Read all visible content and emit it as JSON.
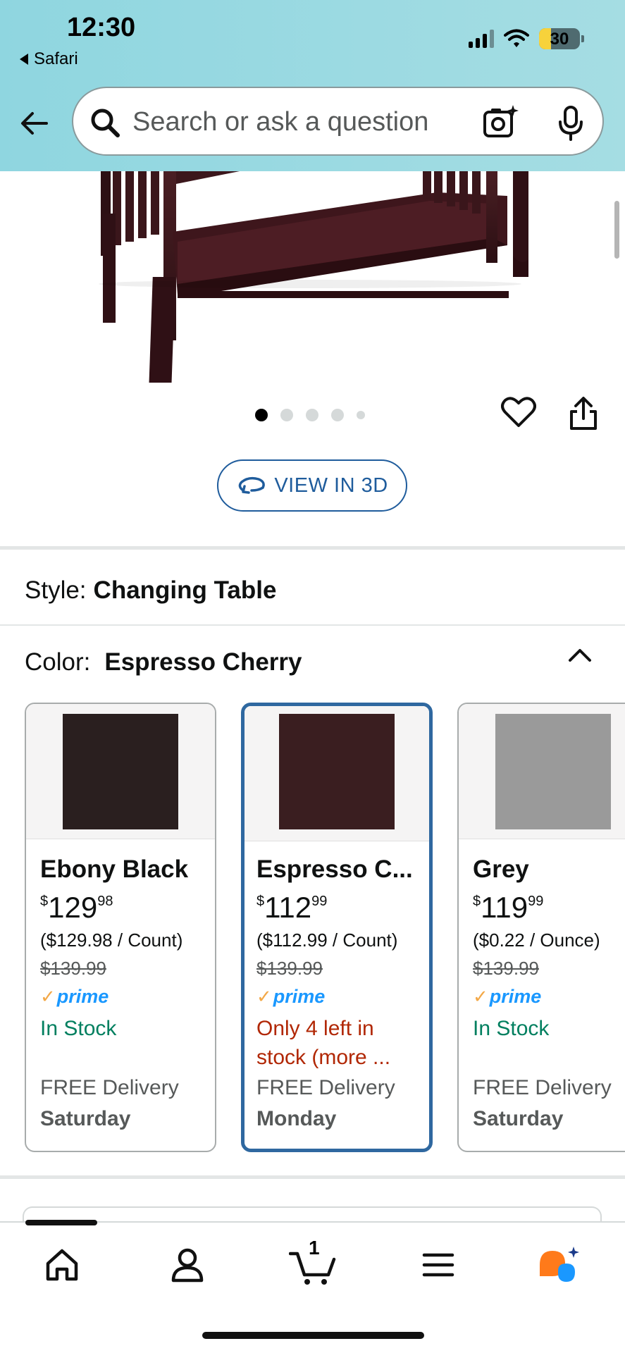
{
  "status_bar": {
    "time": "12:30",
    "back_app": "Safari",
    "battery": "30"
  },
  "search": {
    "placeholder": "Search or ask a question"
  },
  "gallery": {
    "image_count": 5,
    "active_index": 1,
    "view_3d_label": "VIEW IN 3D"
  },
  "style": {
    "label": "Style:",
    "value": "Changing Table"
  },
  "color": {
    "label": "Color:",
    "value": "Espresso Cherry",
    "options": [
      {
        "name": "Ebony Black",
        "swatch_color": "#2a1f1f",
        "price_symbol": "$",
        "price_whole": "129",
        "price_fraction": "98",
        "unit_price": "($129.98 / Count)",
        "was_price": "$139.99",
        "prime": "prime",
        "stock": "In Stock",
        "delivery": "FREE Delivery",
        "delivery_day": "Saturday",
        "selected": false
      },
      {
        "name": "Espresso C...",
        "swatch_color": "#3a1e20",
        "price_symbol": "$",
        "price_whole": "112",
        "price_fraction": "99",
        "unit_price": "($112.99 / Count)",
        "was_price": "$139.99",
        "prime": "prime",
        "stock": "Only 4 left in stock (more ...",
        "delivery": "FREE Delivery",
        "delivery_day": "Monday",
        "selected": true
      },
      {
        "name": "Grey",
        "swatch_color": "#9a9a9a",
        "price_symbol": "$",
        "price_whole": "119",
        "price_fraction": "99",
        "unit_price": "($0.22 / Ounce)",
        "was_price": "$139.99",
        "prime": "prime",
        "stock": "In Stock",
        "delivery": "FREE Delivery",
        "delivery_day": "Saturday",
        "selected": false
      }
    ]
  },
  "bottom_nav": {
    "cart_count": "1",
    "items": [
      "home-icon",
      "account-icon",
      "cart-icon",
      "menu-icon",
      "rufus-assistant-icon"
    ]
  },
  "colors": {
    "header_bg": "#a5dde3",
    "link_blue": "#1f5c9c",
    "selected_border": "#2f68a0",
    "in_stock_green": "#007f5f",
    "low_stock_red": "#b12704",
    "prime_blue": "#1a98ff",
    "prime_check": "#f3a847"
  }
}
